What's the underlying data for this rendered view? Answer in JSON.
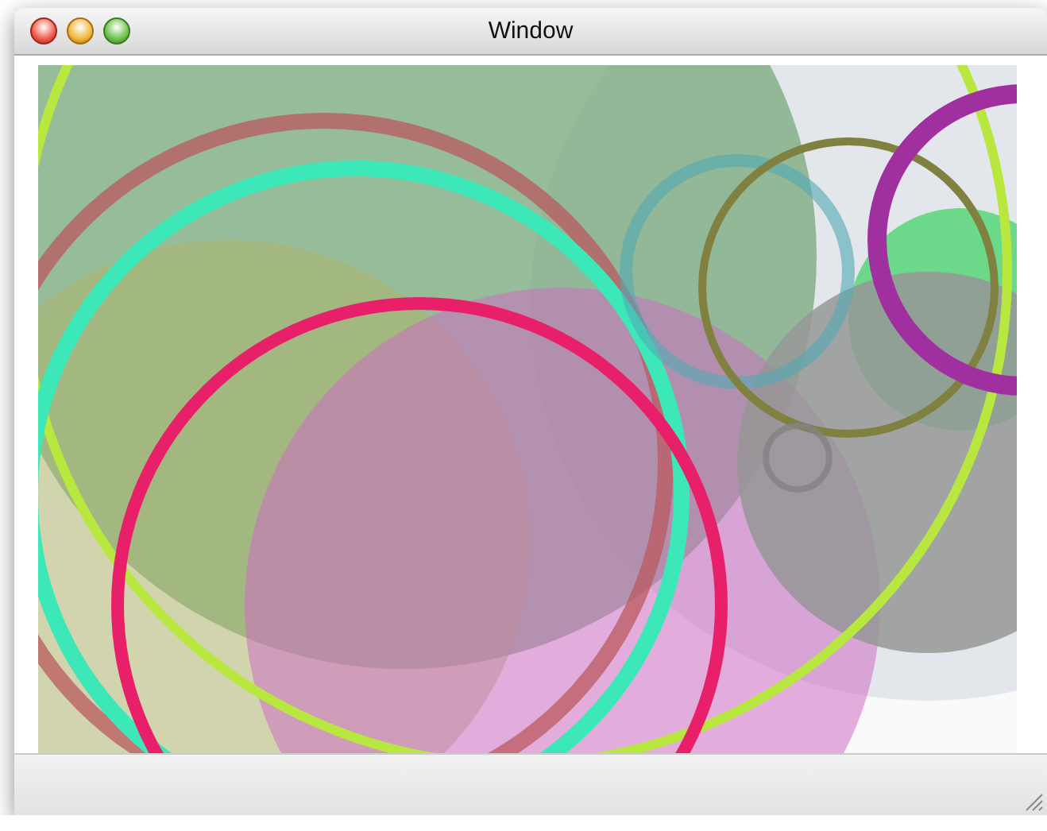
{
  "window": {
    "title": "Window"
  }
}
